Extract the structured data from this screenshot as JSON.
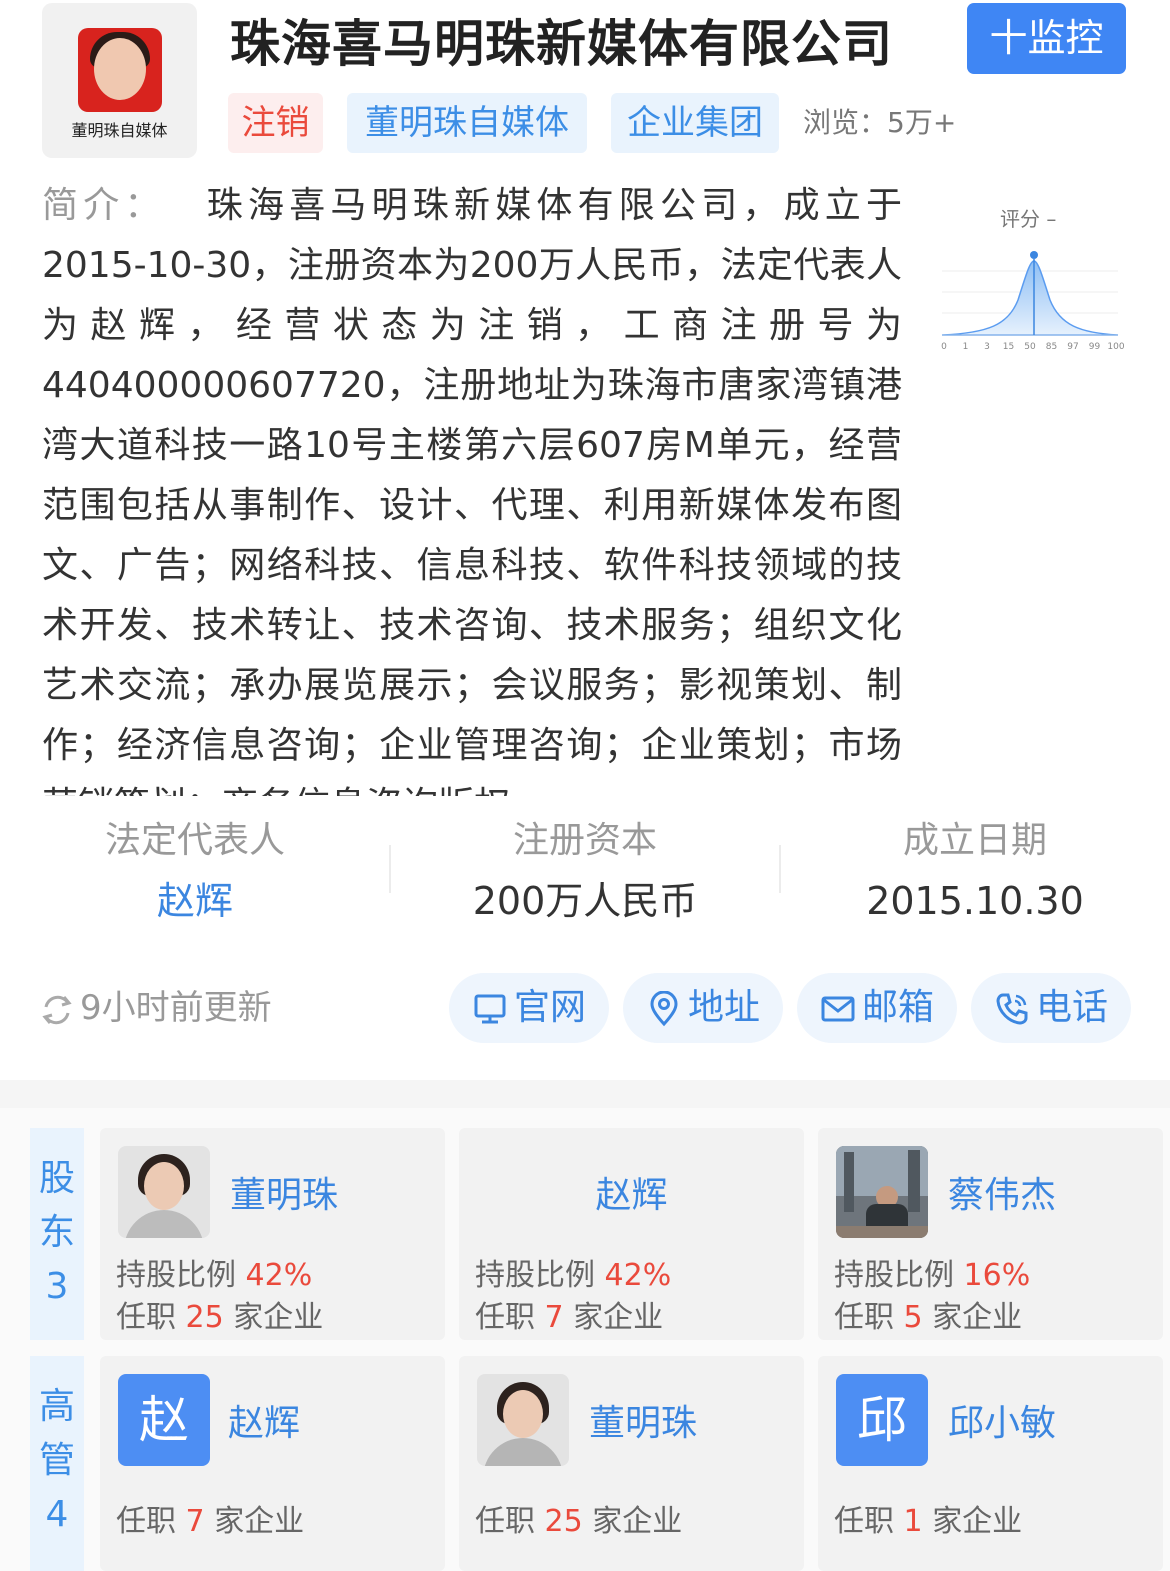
{
  "header": {
    "logo_text": "董明珠自媒体",
    "company_name": "珠海喜马明珠新媒体有限公司",
    "monitor_button": "十监控",
    "tags": [
      "注销",
      "董明珠自媒体",
      "企业集团"
    ],
    "views": "浏览：5万+"
  },
  "intro": {
    "label": "简介：",
    "text": "珠海喜马明珠新媒体有限公司，成立于2015-10-30，注册资本为200万人民币，法定代表人为赵辉，经营状态为注销，工商注册号为440400000607720，注册地址为珠海市唐家湾镇港湾大道科技一路10号主楼第六层607房M单元，经营范围包括从事制作、设计、代理、利用新媒体发布图文、广告；网络科技、信息科技、软件科技领域的技术开发、技术转让、技术咨询、技术服务；组织文化艺术交流；承办展览展示；会议服务；影视策划、制作；经济信息咨询；企业管理咨询；企业策划；市场营销策划；商务信息咨询版权"
  },
  "score": {
    "label": "评分 –",
    "ticks": [
      "0",
      "1",
      "3",
      "15",
      "50",
      "85",
      "97",
      "99",
      "100"
    ],
    "marker_percentile": 50
  },
  "stats": [
    {
      "label": "法定代表人",
      "value": "赵辉"
    },
    {
      "label": "注册资本",
      "value": "200万人民币"
    },
    {
      "label": "成立日期",
      "value": "2015.10.30"
    }
  ],
  "update": {
    "text": "9小时前更新"
  },
  "actions": [
    {
      "label": "官网",
      "icon": "monitor-icon"
    },
    {
      "label": "地址",
      "icon": "location-pin-icon"
    },
    {
      "label": "邮箱",
      "icon": "mail-icon"
    },
    {
      "label": "电话",
      "icon": "phone-icon"
    }
  ],
  "shareholders": {
    "side": [
      "股",
      "东",
      "3"
    ],
    "labels": {
      "ratio": "持股比例",
      "job_prefix": "任职",
      "job_suffix": "家企业"
    },
    "items": [
      {
        "name": "董明珠",
        "ratio": "42%",
        "count": "25",
        "avatar": "photo"
      },
      {
        "name": "赵辉",
        "ratio": "42%",
        "count": "7",
        "avatar": "none"
      },
      {
        "name": "蔡伟杰",
        "ratio": "16%",
        "count": "5",
        "avatar": "photo"
      }
    ]
  },
  "executives": {
    "side": [
      "高",
      "管",
      "4"
    ],
    "items": [
      {
        "name": "赵辉",
        "count": "7",
        "avatar_letter": "赵"
      },
      {
        "name": "董明珠",
        "count": "25",
        "avatar_letter": ""
      },
      {
        "name": "邱小敏",
        "count": "1",
        "avatar_letter": "邱"
      }
    ]
  }
}
